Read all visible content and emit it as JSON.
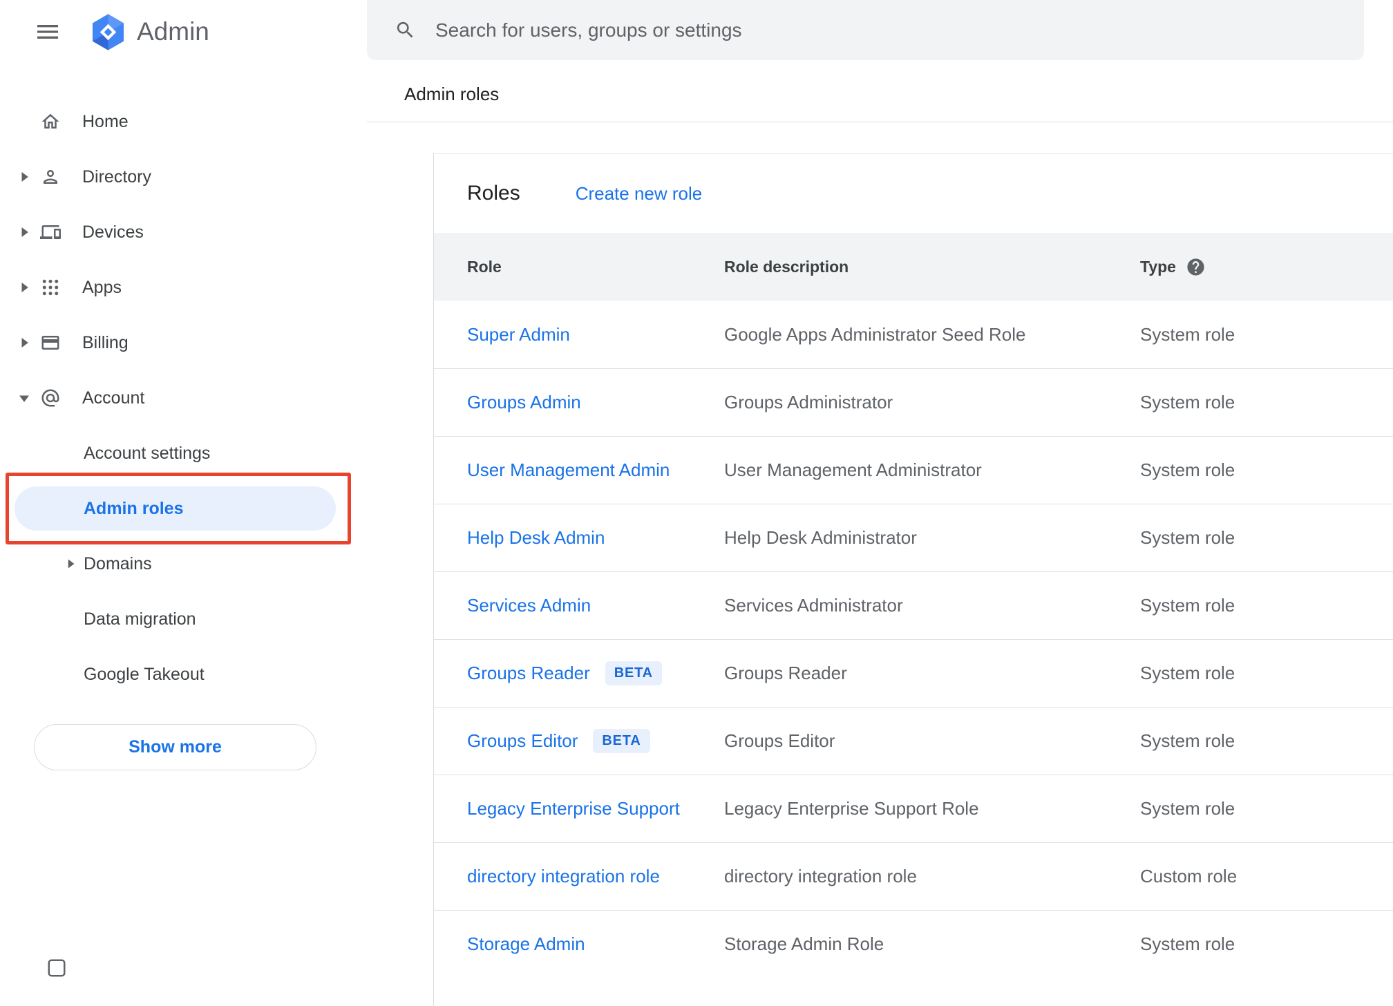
{
  "app": {
    "name": "Admin",
    "brand_color": "#4285f4"
  },
  "search": {
    "placeholder": "Search for users, groups or settings"
  },
  "page": {
    "breadcrumb": "Admin roles"
  },
  "sidebar": {
    "items": [
      {
        "label": "Home"
      },
      {
        "label": "Directory"
      },
      {
        "label": "Devices"
      },
      {
        "label": "Apps"
      },
      {
        "label": "Billing"
      },
      {
        "label": "Account"
      },
      {
        "label": "Account settings"
      },
      {
        "label": "Admin roles"
      },
      {
        "label": "Domains"
      },
      {
        "label": "Data migration"
      },
      {
        "label": "Google Takeout"
      }
    ],
    "show_more": "Show more"
  },
  "roles": {
    "title": "Roles",
    "create_new": "Create new role",
    "columns": {
      "role": "Role",
      "description": "Role description",
      "type": "Type"
    },
    "rows": [
      {
        "role": "Super Admin",
        "badge": "",
        "description": "Google Apps Administrator Seed Role",
        "type": "System role"
      },
      {
        "role": "Groups Admin",
        "badge": "",
        "description": "Groups Administrator",
        "type": "System role"
      },
      {
        "role": "User Management Admin",
        "badge": "",
        "description": "User Management Administrator",
        "type": "System role"
      },
      {
        "role": "Help Desk Admin",
        "badge": "",
        "description": "Help Desk Administrator",
        "type": "System role"
      },
      {
        "role": "Services Admin",
        "badge": "",
        "description": "Services Administrator",
        "type": "System role"
      },
      {
        "role": "Groups Reader",
        "badge": "BETA",
        "description": "Groups Reader",
        "type": "System role"
      },
      {
        "role": "Groups Editor",
        "badge": "BETA",
        "description": "Groups Editor",
        "type": "System role"
      },
      {
        "role": "Legacy Enterprise Support",
        "badge": "",
        "description": "Legacy Enterprise Support Role",
        "type": "System role"
      },
      {
        "role": "directory integration role",
        "badge": "",
        "description": "directory integration role",
        "type": "Custom role"
      },
      {
        "role": "Storage Admin",
        "badge": "",
        "description": "Storage Admin Role",
        "type": "System role"
      }
    ]
  },
  "colors": {
    "accent": "#1a73e8",
    "selected_bg": "#e8f0fe",
    "table_header_bg": "#f1f3f4",
    "annotation": "#e8432d"
  }
}
